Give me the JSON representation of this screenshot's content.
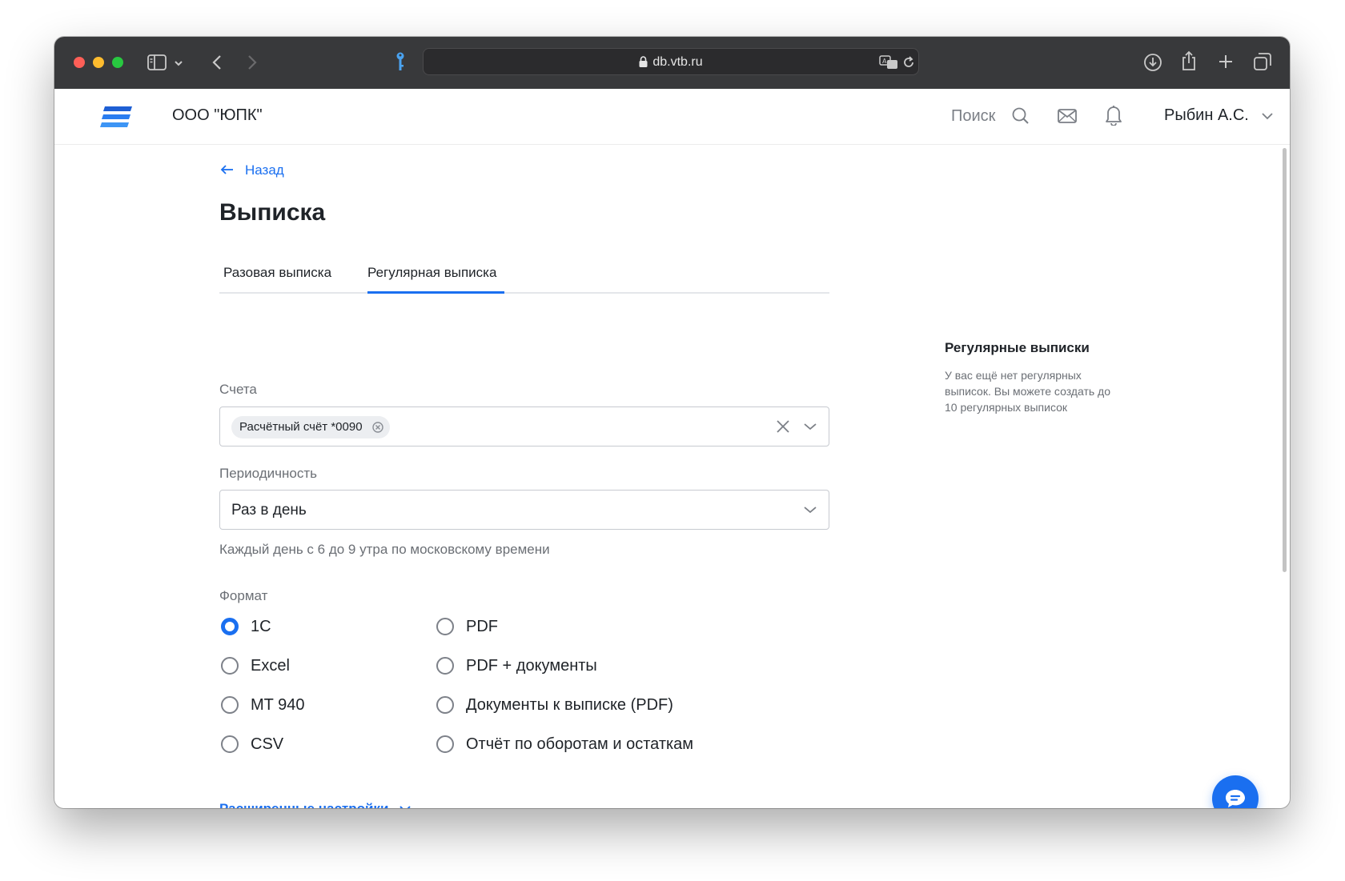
{
  "browser": {
    "url": "db.vtb.ru"
  },
  "header": {
    "company": "ООО \"ЮПК\"",
    "search_label": "Поиск",
    "user_name": "Рыбин А.С."
  },
  "page": {
    "back_label": "Назад",
    "title": "Выписка",
    "tabs": [
      {
        "label": "Разовая выписка",
        "active": false
      },
      {
        "label": "Регулярная выписка",
        "active": true
      }
    ]
  },
  "form": {
    "accounts_label": "Счета",
    "selected_account": "Расчётный счёт *0090",
    "periodicity_label": "Периодичность",
    "periodicity_value": "Раз в день",
    "periodicity_hint": "Каждый день с 6 до 9 утра по московскому времени",
    "format_label": "Формат",
    "formats": [
      {
        "label": "1C",
        "checked": true
      },
      {
        "label": "Excel",
        "checked": false
      },
      {
        "label": "MT 940",
        "checked": false
      },
      {
        "label": "CSV",
        "checked": false
      },
      {
        "label": "PDF",
        "checked": false
      },
      {
        "label": "PDF + документы",
        "checked": false
      },
      {
        "label": "Документы к выписке (PDF)",
        "checked": false
      },
      {
        "label": "Отчёт по оборотам и остаткам",
        "checked": false
      }
    ],
    "advanced_label": "Расширенные настройки"
  },
  "sidebar": {
    "title": "Регулярные выписки",
    "text": "У вас ещё нет регулярных выписок. Вы можете создать до 10 регулярных выписок"
  },
  "colors": {
    "accent": "#1a6ff0",
    "titlebar": "#38393b"
  }
}
